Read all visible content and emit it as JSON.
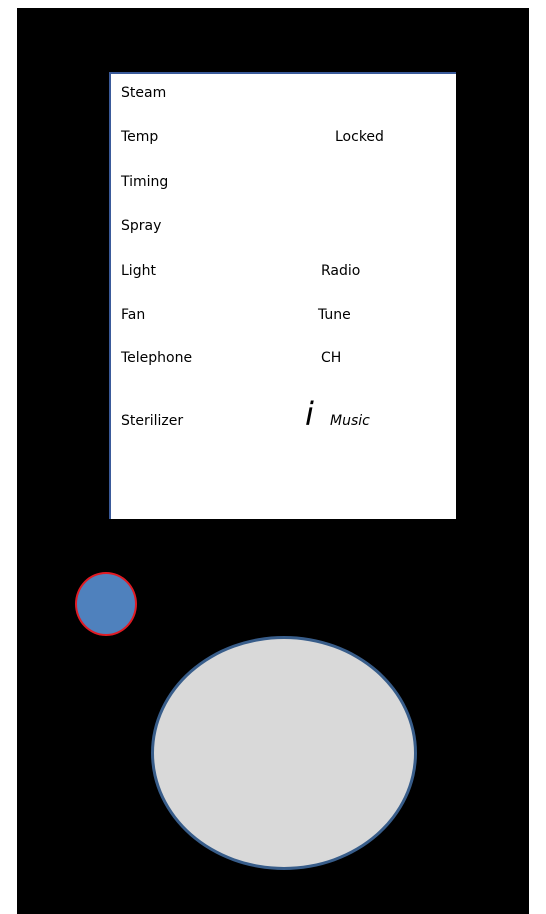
{
  "screen": {
    "left_column": [
      "Steam",
      "Temp",
      "Timing",
      "Spray",
      "Light",
      "Fan",
      "Telephone",
      "Sterilizer"
    ],
    "right_column": {
      "locked": "Locked",
      "radio": "Radio",
      "tune": "Tune",
      "ch": "CH",
      "info_glyph": "i",
      "music": "Music"
    }
  },
  "colors": {
    "device_body": "#000000",
    "screen_bg": "#ffffff",
    "small_button_fill": "#4f81bd",
    "small_button_border": "#e01b24",
    "dial_fill": "#d9d9d9",
    "dial_border": "#385d8a"
  },
  "icons": {
    "info": "info-i-icon"
  }
}
